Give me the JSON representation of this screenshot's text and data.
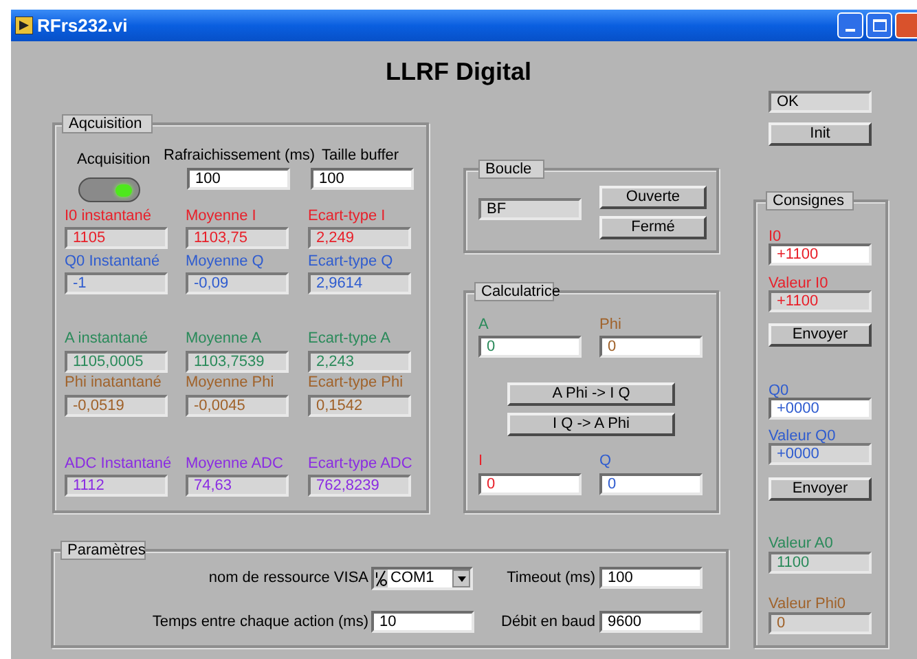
{
  "window": {
    "title": "RFrs232.vi"
  },
  "panel_title": "LLRF Digital",
  "status": {
    "value": "OK"
  },
  "init_button": "Init",
  "acquisition": {
    "label": "Aqcuisition",
    "toggle": {
      "label": "Acquisition",
      "on": true
    },
    "controls": [
      {
        "label": "Rafraichissement (ms)",
        "value": "100"
      },
      {
        "label": "Taille buffer",
        "value": "100"
      }
    ],
    "indicators": [
      {
        "label": "I0 instantané",
        "value": "1105",
        "color": "#e8202a"
      },
      {
        "label": "Moyenne I",
        "value": "1103,75",
        "color": "#e8202a"
      },
      {
        "label": "Ecart-type I",
        "value": "2,249",
        "color": "#e8202a"
      },
      {
        "label": "Q0 Instantané",
        "value": "-1",
        "color": "#2f5ccf"
      },
      {
        "label": "Moyenne Q",
        "value": "-0,09",
        "color": "#2f5ccf"
      },
      {
        "label": "Ecart-type Q",
        "value": "2,9614",
        "color": "#2f5ccf"
      },
      {
        "label": "A instantané",
        "value": "1105,0005",
        "color": "#2a8a5a"
      },
      {
        "label": "Moyenne A",
        "value": "1103,7539",
        "color": "#2a8a5a"
      },
      {
        "label": "Ecart-type A",
        "value": "2,243",
        "color": "#2a8a5a"
      },
      {
        "label": "Phi inatantané",
        "value": "-0,0519",
        "color": "#a0622a"
      },
      {
        "label": "Moyenne Phi",
        "value": "-0,0045",
        "color": "#a0622a"
      },
      {
        "label": "Ecart-type Phi",
        "value": "0,1542",
        "color": "#a0622a"
      },
      {
        "label": "ADC Instantané",
        "value": "1112",
        "color": "#8a2be2"
      },
      {
        "label": "Moyenne ADC",
        "value": "74,63",
        "color": "#8a2be2"
      },
      {
        "label": "Ecart-type ADC",
        "value": "762,8239",
        "color": "#8a2be2"
      }
    ]
  },
  "loop": {
    "label": "Boucle",
    "value": "BF",
    "buttons": [
      "Ouverte",
      "Fermé"
    ]
  },
  "calculator": {
    "label": "Calculatrice",
    "inputs": [
      {
        "label": "A",
        "value": "0",
        "color": "#2a8a5a"
      },
      {
        "label": "Phi",
        "value": "0",
        "color": "#a0622a"
      }
    ],
    "buttons": [
      "A Phi -> I Q",
      "I Q -> A Phi"
    ],
    "outputs": [
      {
        "label": "I",
        "value": "0",
        "color": "#e8202a"
      },
      {
        "label": "Q",
        "value": "0",
        "color": "#2f5ccf"
      }
    ]
  },
  "setpoints": {
    "label": "Consignes",
    "items": [
      {
        "kind": "control",
        "label": "I0",
        "value": "+1100",
        "color": "#e8202a"
      },
      {
        "kind": "indicator",
        "label": "Valeur I0",
        "value": "+1100",
        "color": "#e8202a"
      },
      {
        "kind": "button",
        "label": "Envoyer"
      },
      {
        "kind": "control",
        "label": "Q0",
        "value": "+0000",
        "color": "#2f5ccf"
      },
      {
        "kind": "indicator",
        "label": "Valeur Q0",
        "value": "+0000",
        "color": "#2f5ccf"
      },
      {
        "kind": "button",
        "label": "Envoyer"
      },
      {
        "kind": "indicator",
        "label": "Valeur A0",
        "value": "1100",
        "color": "#2a8a5a"
      },
      {
        "kind": "indicator",
        "label": "Valeur Phi0",
        "value": "0",
        "color": "#a0622a"
      }
    ]
  },
  "parameters": {
    "label": "Paramètres",
    "fields": [
      {
        "kind": "combo",
        "label": "nom de ressource VISA",
        "value": "COM1"
      },
      {
        "kind": "control",
        "label": "Timeout (ms)",
        "value": "100"
      },
      {
        "kind": "control",
        "label": "Temps entre chaque action (ms)",
        "value": "10"
      },
      {
        "kind": "control",
        "label": "Débit en baud",
        "value": "9600"
      }
    ]
  }
}
